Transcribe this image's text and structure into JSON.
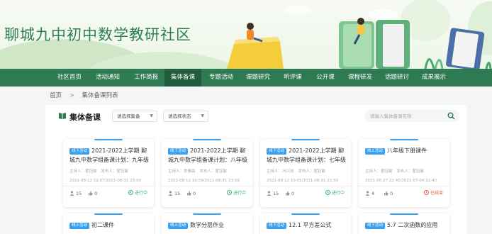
{
  "site_title": "聊城九中初中数学教研社区",
  "nav": {
    "items": [
      {
        "label": "社区首页"
      },
      {
        "label": "活动通知"
      },
      {
        "label": "工作简报"
      },
      {
        "label": "集体备课"
      },
      {
        "label": "专题活动"
      },
      {
        "label": "课题研究"
      },
      {
        "label": "听评课"
      },
      {
        "label": "公开课"
      },
      {
        "label": "课程研发"
      },
      {
        "label": "话题研讨"
      },
      {
        "label": "成果展示"
      }
    ],
    "active_index": 3
  },
  "breadcrumb": {
    "home": "首页",
    "separator": ">",
    "current": "集体备课列表"
  },
  "panel": {
    "title": "集体备课",
    "select_category": "请选择集备",
    "select_status": "请选择状态",
    "search_placeholder": "请输入集体备课名称"
  },
  "colors": {
    "nav_bg": "#2e7a52",
    "nav_active": "#1f5d3c",
    "title_green": "#2f7d50",
    "tag_blue": "#3aa0f0",
    "status_ongoing": "#3eb36a",
    "status_ended": "#e25a4a"
  },
  "cards": [
    {
      "tag": "线下活动",
      "title": "2021-2022上学期 聊城九中数学组备课计划：九年级",
      "host": "主持人：翟钰敏",
      "publisher": "发布人：翟钰敏",
      "date": "2021-08-12 11:07/2021-08-31 23:59",
      "views": "15",
      "likes": "0",
      "status": "进行中",
      "status_type": "ongoing"
    },
    {
      "tag": "线下活动",
      "title": "2021-2022上学期 聊城九中数学组备课计划：八年级",
      "host": "主持人：常雅晨",
      "publisher": "发布人：翟钰敏",
      "date": "2021-08-12 10:59/2021-08-31 23:59",
      "views": "15",
      "likes": "0",
      "status": "进行中",
      "status_type": "ongoing"
    },
    {
      "tag": "线下活动",
      "title": "2021-2022上学期 聊城九中数学组备课计划：七年级",
      "host": "主持人：冯兴法",
      "publisher": "发布人：翟钰敏",
      "date": "2021-08-12 10:55/2021-08-31 23:59",
      "views": "15",
      "likes": "0",
      "status": "进行中",
      "status_type": "ongoing"
    },
    {
      "tag": "线上活动",
      "title": "八年级下册课件",
      "host": "主持人：翟钰敏",
      "publisher": "发布人：翟钰敏",
      "date": "2021-06-27 22:40/2021-07-04 22:40",
      "views": "4",
      "likes": "0",
      "status": "已结束",
      "status_type": "ended"
    },
    {
      "tag": "线上活动",
      "title": "初二课件"
    },
    {
      "tag": "线上活动",
      "title": "数学分层作业"
    },
    {
      "tag": "线下活动",
      "title": "12.1 平方差公式"
    },
    {
      "tag": "线下活动",
      "title": "5.7 二次函数的应用"
    }
  ]
}
